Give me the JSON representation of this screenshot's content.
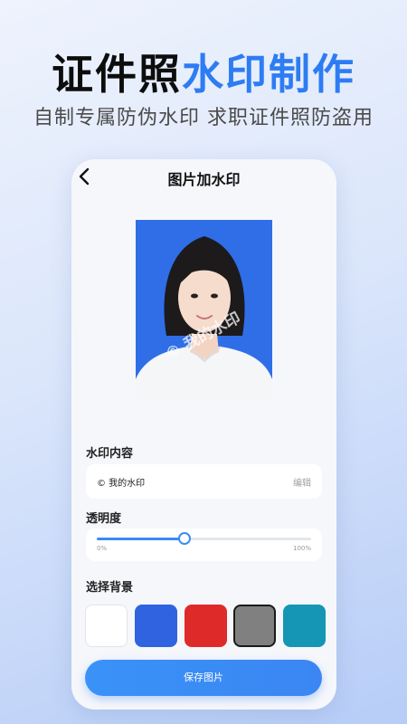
{
  "banner": {
    "title_dark": "证件照",
    "title_accent": "水印制作",
    "subtitle": "自制专属防伪水印 求职证件照防盗用"
  },
  "screen": {
    "nav_title": "图片加水印",
    "watermark_overlay": "© 我的水印",
    "watermark_section": {
      "label": "水印内容",
      "value": "© 我的水印",
      "edit_label": "编辑"
    },
    "opacity_section": {
      "label": "透明度",
      "min_label": "0%",
      "max_label": "100%",
      "value_percent": 41
    },
    "background_section": {
      "label": "选择背景",
      "colors": [
        "#ffffff",
        "#2f63e0",
        "#df2a2a",
        "#808080",
        "#1596b4"
      ],
      "selected_index": 3
    },
    "save_label": "保存图片"
  }
}
